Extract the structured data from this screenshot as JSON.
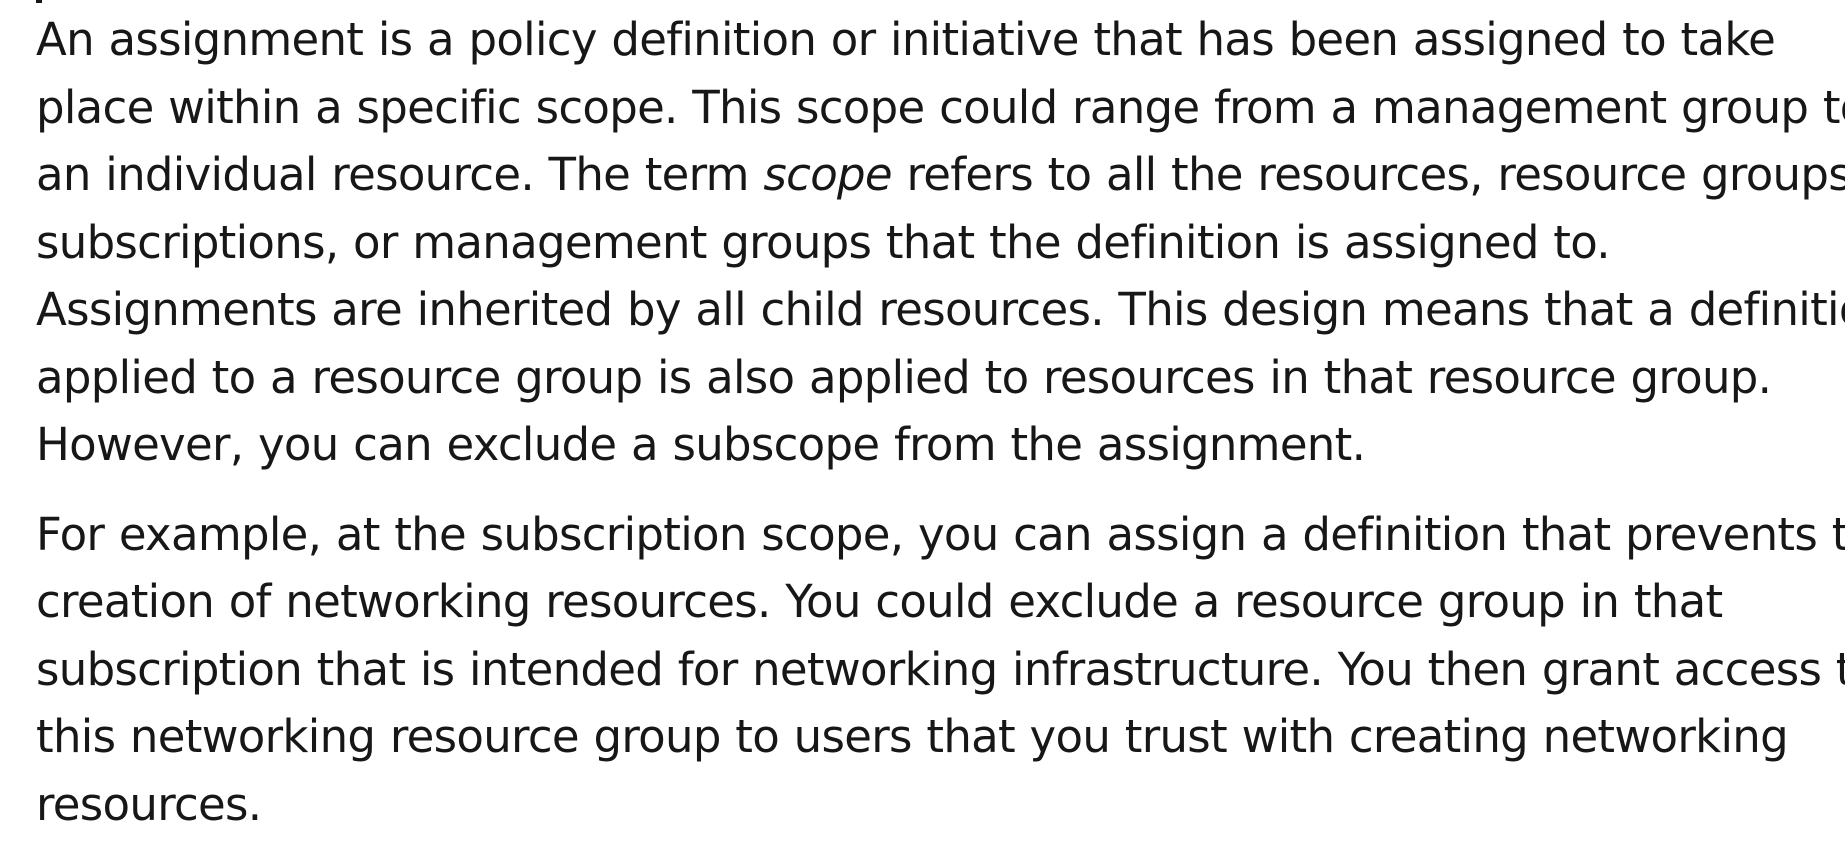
{
  "paragraphs": [
    {
      "lines": [
        "An assignment is a policy definition or initiative that has been assigned to take",
        "place within a specific scope. This scope could range from a management group to",
        {
          "before": "an individual resource. The term ",
          "emphasis": "scope",
          "after": " refers to all the resources, resource groups,"
        },
        "subscriptions, or management groups that the definition is assigned to.",
        "Assignments are inherited by all child resources. This design means that a definition",
        "applied to a resource group is also applied to resources in that resource group.",
        "However, you can exclude a subscope from the assignment."
      ]
    },
    {
      "lines": [
        "For example, at the subscription scope, you can assign a definition that prevents the",
        "creation of networking resources. You could exclude a resource group in that",
        "subscription that is intended for networking infrastructure. You then grant access to",
        "this networking resource group to users that you trust with creating networking",
        "resources."
      ]
    }
  ]
}
